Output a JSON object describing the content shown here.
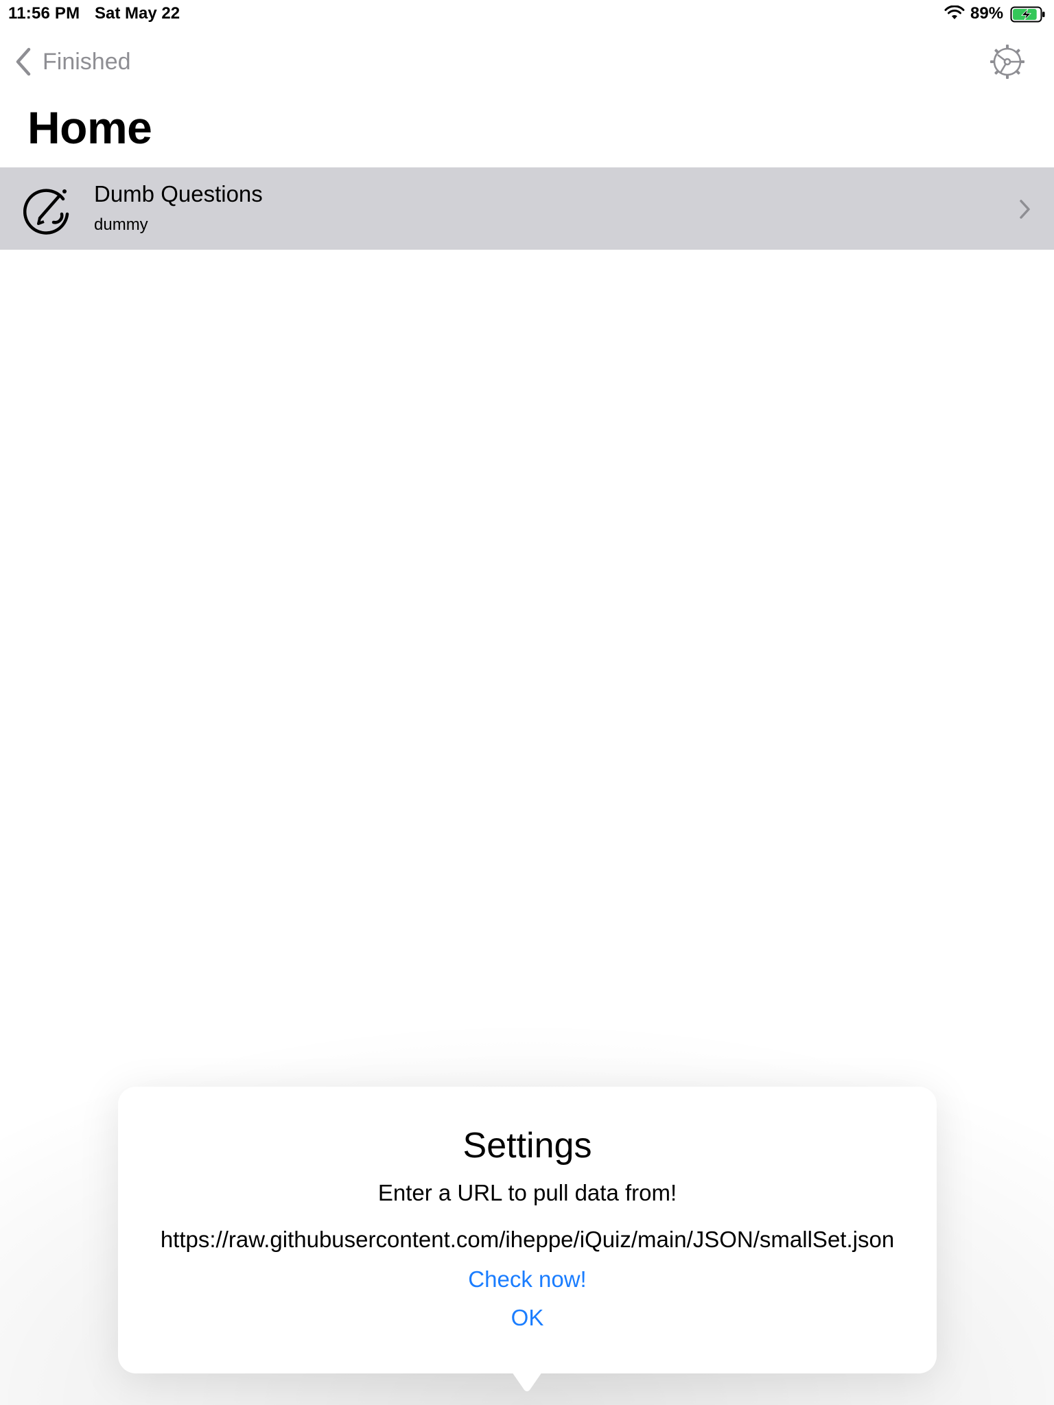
{
  "status_bar": {
    "time": "11:56 PM",
    "date": "Sat May 22",
    "battery_percent": "89%",
    "battery_level": 0.89,
    "icons": [
      "wifi-icon",
      "battery-charging-icon"
    ]
  },
  "nav": {
    "back_label": "Finished",
    "back_icon": "chevron-left-icon",
    "settings_icon": "gear-icon"
  },
  "page": {
    "title": "Home"
  },
  "list": {
    "items": [
      {
        "title": "Dumb Questions",
        "subtitle": "dummy",
        "icon": "quiz-pencil-icon",
        "accessory": "chevron-right-icon"
      }
    ]
  },
  "popover": {
    "title": "Settings",
    "message": "Enter a URL to pull data from!",
    "url_value": "https://raw.githubusercontent.com/iheppe/iQuiz/main/JSON/smallSet.json",
    "check_label": "Check now!",
    "ok_label": "OK"
  },
  "colors": {
    "accent": "#1a7dff",
    "row_highlight": "#d1d1d6",
    "secondary_text": "#8e8e93",
    "battery_green": "#34c759"
  }
}
